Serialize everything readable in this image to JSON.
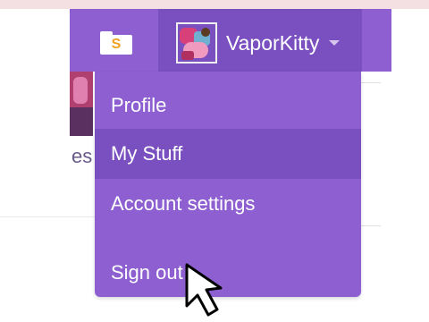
{
  "header": {
    "stuff_icon_letter": "S",
    "username": "VaporKitty"
  },
  "side": {
    "partial_label": "es"
  },
  "menu": {
    "items": [
      {
        "label": "Profile"
      },
      {
        "label": "My Stuff",
        "highlighted": true
      },
      {
        "label": "Account settings"
      },
      {
        "label": "Sign out"
      }
    ]
  },
  "colors": {
    "brand_purple": "#8d5fd0",
    "dark_purple": "#7a4fc0",
    "text": "#ffffff"
  },
  "icons": [
    "folder-icon",
    "avatar",
    "caret-down-icon",
    "mouse-pointer-icon"
  ]
}
